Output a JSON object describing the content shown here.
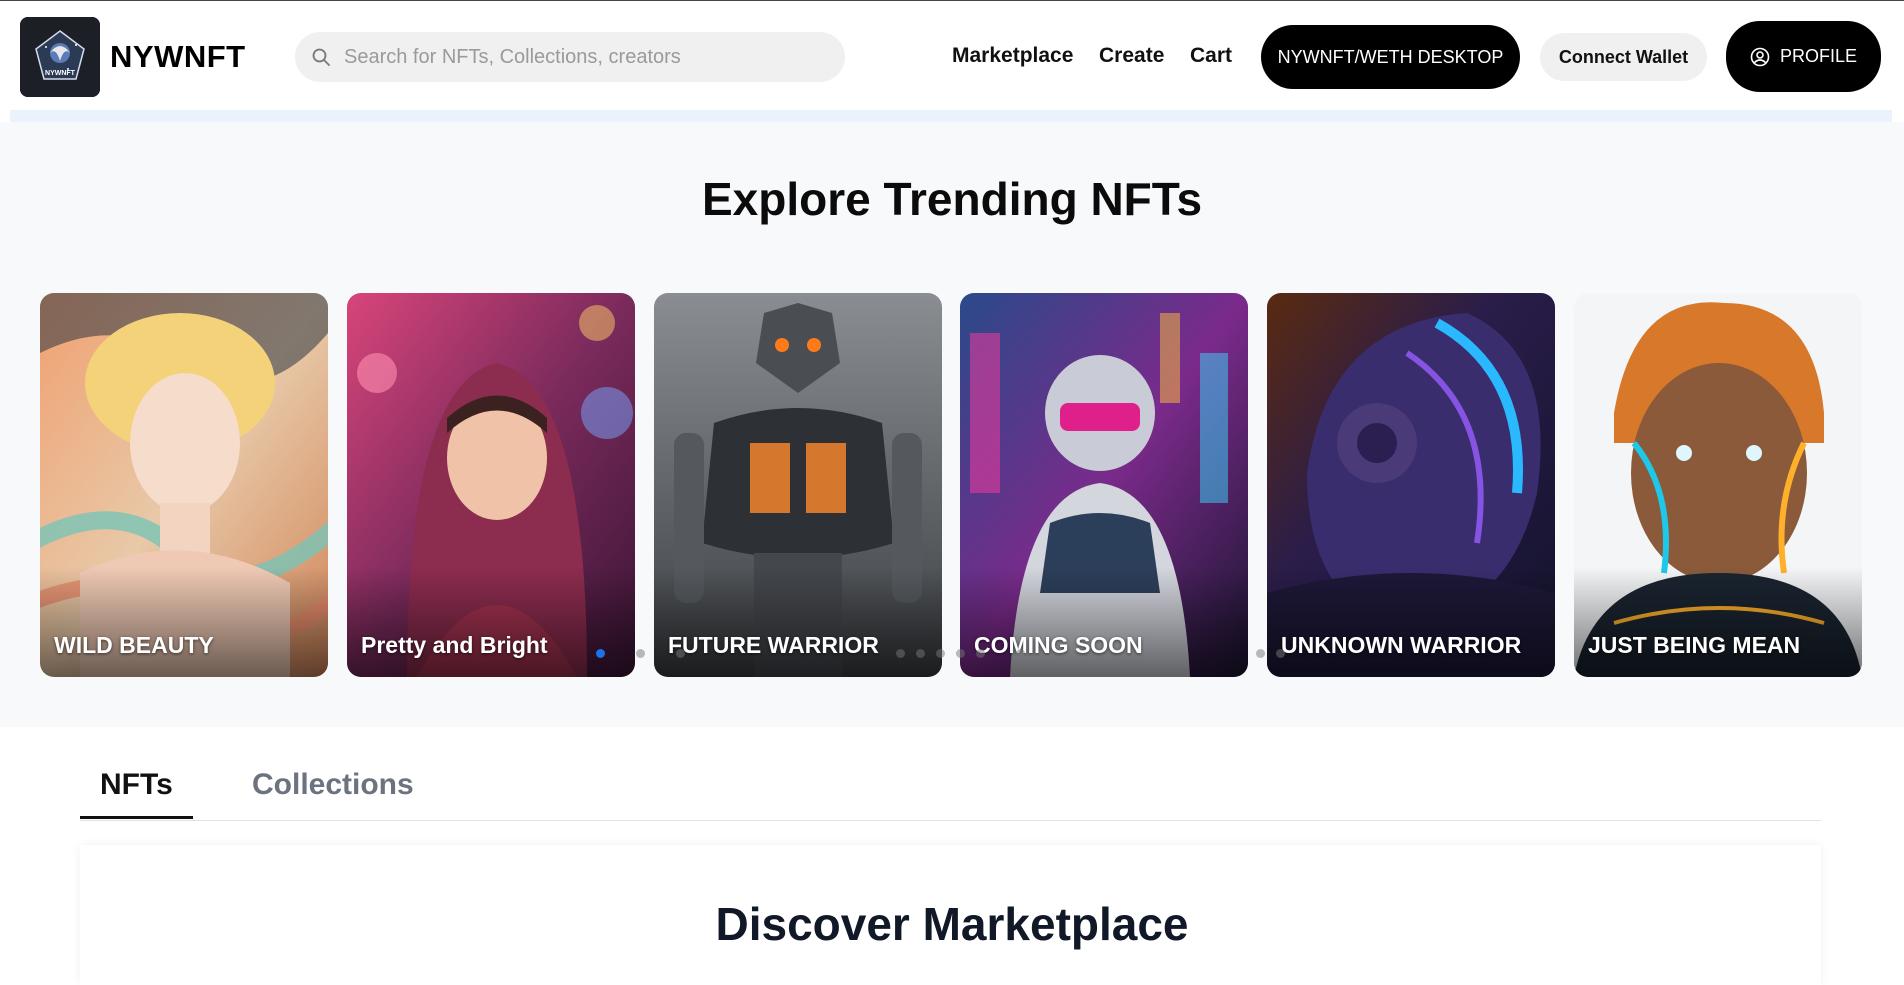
{
  "brand": {
    "name": "NYWNFT",
    "logo_caption": "NYWNFT"
  },
  "search": {
    "placeholder": "Search for NFTs, Collections, creators",
    "icon": "search-icon"
  },
  "nav": {
    "marketplace": "Marketplace",
    "create": "Create",
    "cart": "Cart"
  },
  "buttons": {
    "desktop": "NYWNFT/WETH DESKTOP",
    "connect_wallet": "Connect Wallet",
    "profile": "PROFILE"
  },
  "hero": {
    "title": "Explore Trending NFTs",
    "cards": [
      {
        "label": "WILD BEAUTY"
      },
      {
        "label": "Pretty and Bright"
      },
      {
        "label": "FUTURE WARRIOR"
      },
      {
        "label": "COMING SOON"
      },
      {
        "label": "UNKNOWN WARRIOR"
      },
      {
        "label": "JUST BEING MEAN"
      }
    ],
    "carousel_active_index": 0
  },
  "tabs": {
    "nfts": "NFTs",
    "collections": "Collections",
    "active": "NFTs"
  },
  "marketplace": {
    "title": "Discover Marketplace"
  },
  "colors": {
    "accent_dark": "#000000",
    "active_dot": "#1a73e8",
    "hero_bg": "#f7f9fb",
    "tab_inactive": "#6b7280"
  }
}
